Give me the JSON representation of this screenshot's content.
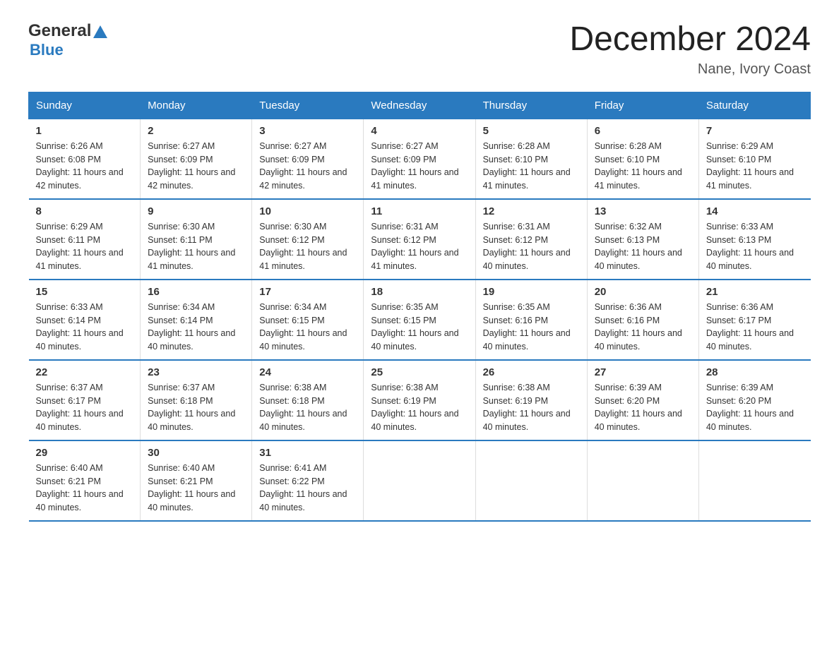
{
  "header": {
    "logo_general": "General",
    "logo_blue": "Blue",
    "month_title": "December 2024",
    "location": "Nane, Ivory Coast"
  },
  "days_of_week": [
    "Sunday",
    "Monday",
    "Tuesday",
    "Wednesday",
    "Thursday",
    "Friday",
    "Saturday"
  ],
  "weeks": [
    [
      {
        "day": "1",
        "sunrise": "Sunrise: 6:26 AM",
        "sunset": "Sunset: 6:08 PM",
        "daylight": "Daylight: 11 hours and 42 minutes."
      },
      {
        "day": "2",
        "sunrise": "Sunrise: 6:27 AM",
        "sunset": "Sunset: 6:09 PM",
        "daylight": "Daylight: 11 hours and 42 minutes."
      },
      {
        "day": "3",
        "sunrise": "Sunrise: 6:27 AM",
        "sunset": "Sunset: 6:09 PM",
        "daylight": "Daylight: 11 hours and 42 minutes."
      },
      {
        "day": "4",
        "sunrise": "Sunrise: 6:27 AM",
        "sunset": "Sunset: 6:09 PM",
        "daylight": "Daylight: 11 hours and 41 minutes."
      },
      {
        "day": "5",
        "sunrise": "Sunrise: 6:28 AM",
        "sunset": "Sunset: 6:10 PM",
        "daylight": "Daylight: 11 hours and 41 minutes."
      },
      {
        "day": "6",
        "sunrise": "Sunrise: 6:28 AM",
        "sunset": "Sunset: 6:10 PM",
        "daylight": "Daylight: 11 hours and 41 minutes."
      },
      {
        "day": "7",
        "sunrise": "Sunrise: 6:29 AM",
        "sunset": "Sunset: 6:10 PM",
        "daylight": "Daylight: 11 hours and 41 minutes."
      }
    ],
    [
      {
        "day": "8",
        "sunrise": "Sunrise: 6:29 AM",
        "sunset": "Sunset: 6:11 PM",
        "daylight": "Daylight: 11 hours and 41 minutes."
      },
      {
        "day": "9",
        "sunrise": "Sunrise: 6:30 AM",
        "sunset": "Sunset: 6:11 PM",
        "daylight": "Daylight: 11 hours and 41 minutes."
      },
      {
        "day": "10",
        "sunrise": "Sunrise: 6:30 AM",
        "sunset": "Sunset: 6:12 PM",
        "daylight": "Daylight: 11 hours and 41 minutes."
      },
      {
        "day": "11",
        "sunrise": "Sunrise: 6:31 AM",
        "sunset": "Sunset: 6:12 PM",
        "daylight": "Daylight: 11 hours and 41 minutes."
      },
      {
        "day": "12",
        "sunrise": "Sunrise: 6:31 AM",
        "sunset": "Sunset: 6:12 PM",
        "daylight": "Daylight: 11 hours and 40 minutes."
      },
      {
        "day": "13",
        "sunrise": "Sunrise: 6:32 AM",
        "sunset": "Sunset: 6:13 PM",
        "daylight": "Daylight: 11 hours and 40 minutes."
      },
      {
        "day": "14",
        "sunrise": "Sunrise: 6:33 AM",
        "sunset": "Sunset: 6:13 PM",
        "daylight": "Daylight: 11 hours and 40 minutes."
      }
    ],
    [
      {
        "day": "15",
        "sunrise": "Sunrise: 6:33 AM",
        "sunset": "Sunset: 6:14 PM",
        "daylight": "Daylight: 11 hours and 40 minutes."
      },
      {
        "day": "16",
        "sunrise": "Sunrise: 6:34 AM",
        "sunset": "Sunset: 6:14 PM",
        "daylight": "Daylight: 11 hours and 40 minutes."
      },
      {
        "day": "17",
        "sunrise": "Sunrise: 6:34 AM",
        "sunset": "Sunset: 6:15 PM",
        "daylight": "Daylight: 11 hours and 40 minutes."
      },
      {
        "day": "18",
        "sunrise": "Sunrise: 6:35 AM",
        "sunset": "Sunset: 6:15 PM",
        "daylight": "Daylight: 11 hours and 40 minutes."
      },
      {
        "day": "19",
        "sunrise": "Sunrise: 6:35 AM",
        "sunset": "Sunset: 6:16 PM",
        "daylight": "Daylight: 11 hours and 40 minutes."
      },
      {
        "day": "20",
        "sunrise": "Sunrise: 6:36 AM",
        "sunset": "Sunset: 6:16 PM",
        "daylight": "Daylight: 11 hours and 40 minutes."
      },
      {
        "day": "21",
        "sunrise": "Sunrise: 6:36 AM",
        "sunset": "Sunset: 6:17 PM",
        "daylight": "Daylight: 11 hours and 40 minutes."
      }
    ],
    [
      {
        "day": "22",
        "sunrise": "Sunrise: 6:37 AM",
        "sunset": "Sunset: 6:17 PM",
        "daylight": "Daylight: 11 hours and 40 minutes."
      },
      {
        "day": "23",
        "sunrise": "Sunrise: 6:37 AM",
        "sunset": "Sunset: 6:18 PM",
        "daylight": "Daylight: 11 hours and 40 minutes."
      },
      {
        "day": "24",
        "sunrise": "Sunrise: 6:38 AM",
        "sunset": "Sunset: 6:18 PM",
        "daylight": "Daylight: 11 hours and 40 minutes."
      },
      {
        "day": "25",
        "sunrise": "Sunrise: 6:38 AM",
        "sunset": "Sunset: 6:19 PM",
        "daylight": "Daylight: 11 hours and 40 minutes."
      },
      {
        "day": "26",
        "sunrise": "Sunrise: 6:38 AM",
        "sunset": "Sunset: 6:19 PM",
        "daylight": "Daylight: 11 hours and 40 minutes."
      },
      {
        "day": "27",
        "sunrise": "Sunrise: 6:39 AM",
        "sunset": "Sunset: 6:20 PM",
        "daylight": "Daylight: 11 hours and 40 minutes."
      },
      {
        "day": "28",
        "sunrise": "Sunrise: 6:39 AM",
        "sunset": "Sunset: 6:20 PM",
        "daylight": "Daylight: 11 hours and 40 minutes."
      }
    ],
    [
      {
        "day": "29",
        "sunrise": "Sunrise: 6:40 AM",
        "sunset": "Sunset: 6:21 PM",
        "daylight": "Daylight: 11 hours and 40 minutes."
      },
      {
        "day": "30",
        "sunrise": "Sunrise: 6:40 AM",
        "sunset": "Sunset: 6:21 PM",
        "daylight": "Daylight: 11 hours and 40 minutes."
      },
      {
        "day": "31",
        "sunrise": "Sunrise: 6:41 AM",
        "sunset": "Sunset: 6:22 PM",
        "daylight": "Daylight: 11 hours and 40 minutes."
      },
      {
        "day": "",
        "sunrise": "",
        "sunset": "",
        "daylight": ""
      },
      {
        "day": "",
        "sunrise": "",
        "sunset": "",
        "daylight": ""
      },
      {
        "day": "",
        "sunrise": "",
        "sunset": "",
        "daylight": ""
      },
      {
        "day": "",
        "sunrise": "",
        "sunset": "",
        "daylight": ""
      }
    ]
  ]
}
